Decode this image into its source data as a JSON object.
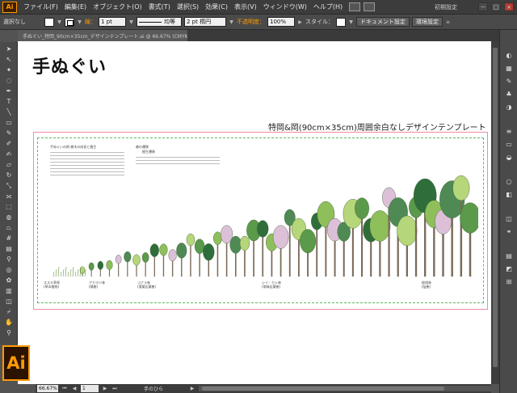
{
  "app": {
    "badge": "Ai",
    "logo": "Ai"
  },
  "menu": {
    "items": [
      "ファイル(F)",
      "編集(E)",
      "オブジェクト(O)",
      "書式(T)",
      "選択(S)",
      "効果(C)",
      "表示(V)",
      "ウィンドウ(W)",
      "ヘルプ(H)"
    ],
    "workspace": "初期設定",
    "window_buttons": [
      "－",
      "□",
      "×"
    ]
  },
  "control": {
    "selection_label": "選択なし",
    "stroke_label": "線：",
    "stroke_weight": "1 pt",
    "profile_label": "均等",
    "brush_label": "2 pt 楕円",
    "opacity_label": "不透明度：",
    "opacity_value": "100%",
    "style_label": "スタイル：",
    "doc_settings": "ドキュメント設定",
    "prefs": "環境設定"
  },
  "document": {
    "tab_title": "手ぬぐい_特岡_90cm×35cm_デザインテンプレート.ai @ 66.67% (CMYK/プレビュー)"
  },
  "artboard": {
    "heading": "手ぬぐい",
    "template_title": "特岡&岡(90cm×35cm)周囲余白なしデザインテンプレート",
    "block1_title": "手ぬぐいの柄 樹木の成長と植生",
    "block2_title": "森の遷移",
    "block2_sub": "植生遷移",
    "stage_labels": [
      "ススキ草原",
      "アカマツ林",
      "コナラ林",
      "シイ・カシ林",
      "極相林"
    ],
    "stage_subs": [
      "(草本植物)",
      "(陽樹)",
      "(落葉広葉樹)",
      "(常緑広葉樹)",
      "(陰樹)"
    ]
  },
  "status": {
    "zoom": "66.67%",
    "page": "1",
    "tool_name": "手のひら"
  },
  "colors": {
    "accent": "#ff9a00",
    "frame_pink": "#f08ca0",
    "frame_green": "#5fb85f",
    "tree_dark": "#2f6e3a",
    "tree_mid": "#5a9a4a",
    "tree_light": "#b6d67a"
  },
  "icons": {
    "tools": [
      "selection-arrow-icon",
      "direct-select-icon",
      "magic-wand-icon",
      "lasso-icon",
      "pen-icon",
      "type-icon",
      "line-icon",
      "rectangle-icon",
      "paintbrush-icon",
      "pencil-icon",
      "blob-brush-icon",
      "eraser-icon",
      "rotate-icon",
      "scale-icon",
      "width-icon",
      "free-transform-icon",
      "shape-builder-icon",
      "perspective-icon",
      "mesh-icon",
      "gradient-icon",
      "eyedropper-icon",
      "blend-icon",
      "symbol-sprayer-icon",
      "graph-icon",
      "artboard-icon",
      "slice-icon",
      "hand-icon",
      "zoom-icon"
    ],
    "panels": [
      "color-panel-icon",
      "swatches-icon",
      "brushes-icon",
      "symbols-icon",
      "graphic-styles-icon",
      "stroke-icon",
      "gradient-panel-icon",
      "transparency-icon",
      "appearance-icon",
      "layers-icon",
      "artboards-icon",
      "links-icon",
      "align-icon",
      "pathfinder-icon",
      "transform-icon"
    ]
  }
}
